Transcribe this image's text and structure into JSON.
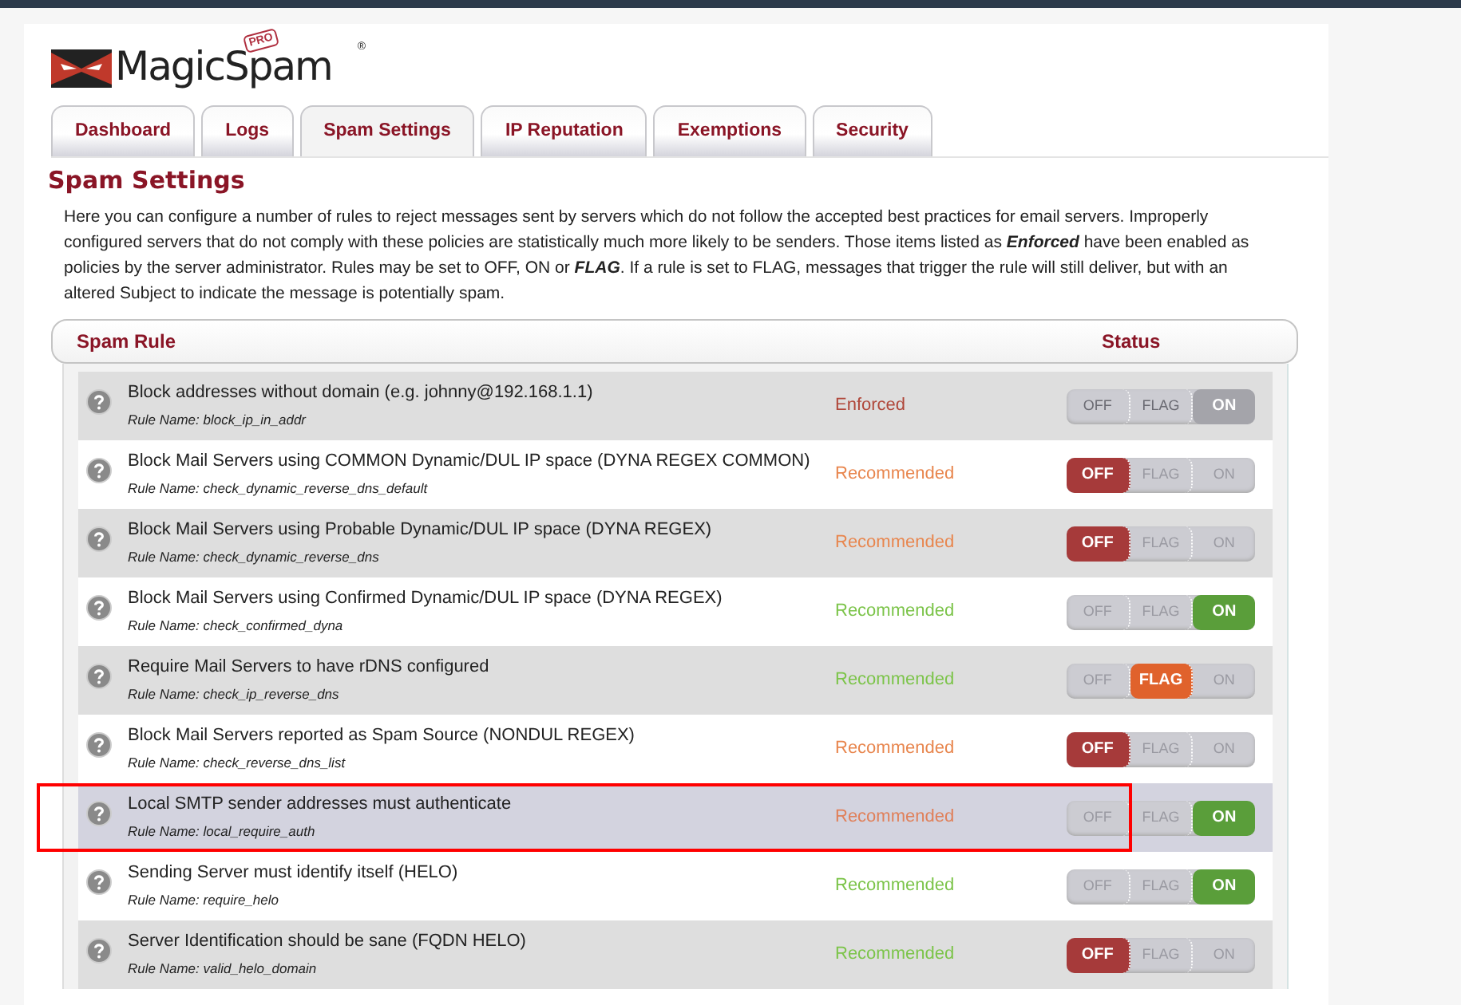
{
  "logo": {
    "name": "MagicSpam",
    "badge": "PRO",
    "mark": "®"
  },
  "tabs": [
    {
      "label": "Dashboard",
      "selected": false
    },
    {
      "label": "Logs",
      "selected": false
    },
    {
      "label": "Spam Settings",
      "selected": true
    },
    {
      "label": "IP Reputation",
      "selected": false
    },
    {
      "label": "Exemptions",
      "selected": false
    },
    {
      "label": "Security",
      "selected": false
    }
  ],
  "heading": "Spam Settings",
  "intro": "Here you can configure a number of rules to reject messages sent by servers which do not follow the accepted best practices for email servers. Improperly configured servers that do not comply with these policies are statistically much more likely to be senders. Those items listed as **Enforced** have been enabled as policies by the server administrator. Rules may be set to OFF, ON or **FLAG**. If a rule is set to FLAG, messages that trigger the rule will still deliver, but with an altered Subject to indicate the message is potentially spam.",
  "table": {
    "columns": [
      "Spam Rule",
      "Status"
    ],
    "rows": [
      {
        "title": "Block addresses without domain (e.g. johnny@192.168.1.1)",
        "rule_name": "Rule Name: block_ip_in_addr",
        "status": "Enforced",
        "color": "#b0473a",
        "disabled": true,
        "highlighted": false,
        "options": [
          {
            "label": "OFF",
            "selected": false
          },
          {
            "label": "FLAG",
            "selected": false
          },
          {
            "label": "ON",
            "selected": true
          }
        ]
      },
      {
        "title": "Block Mail Servers using COMMON Dynamic/DUL IP space (DYNA REGEX COMMON)",
        "rule_name": "Rule Name: check_dynamic_reverse_dns_default",
        "status": "Recommended",
        "color": "#e8864e",
        "disabled": false,
        "highlighted": false,
        "options": [
          {
            "label": "OFF",
            "selected": true
          },
          {
            "label": "FLAG",
            "selected": false
          },
          {
            "label": "ON",
            "selected": false
          }
        ]
      },
      {
        "title": "Block Mail Servers using Probable Dynamic/DUL IP space (DYNA REGEX)",
        "rule_name": "Rule Name: check_dynamic_reverse_dns",
        "status": "Recommended",
        "color": "#e8864e",
        "disabled": false,
        "highlighted": false,
        "options": [
          {
            "label": "OFF",
            "selected": true
          },
          {
            "label": "FLAG",
            "selected": false
          },
          {
            "label": "ON",
            "selected": false
          }
        ]
      },
      {
        "title": "Block Mail Servers using Confirmed Dynamic/DUL IP space (DYNA REGEX)",
        "rule_name": "Rule Name: check_confirmed_dyna",
        "status": "Recommended",
        "color": "#7cc44a",
        "disabled": false,
        "highlighted": false,
        "options": [
          {
            "label": "OFF",
            "selected": false
          },
          {
            "label": "FLAG",
            "selected": false
          },
          {
            "label": "ON",
            "selected": true
          }
        ]
      },
      {
        "title": "Require Mail Servers to have rDNS configured",
        "rule_name": "Rule Name: check_ip_reverse_dns",
        "status": "Recommended",
        "color": "#7cc44a",
        "disabled": false,
        "highlighted": false,
        "options": [
          {
            "label": "OFF",
            "selected": false
          },
          {
            "label": "FLAG",
            "selected": true
          },
          {
            "label": "ON",
            "selected": false
          }
        ]
      },
      {
        "title": "Block Mail Servers reported as Spam Source (NONDUL REGEX)",
        "rule_name": "Rule Name: check_reverse_dns_list",
        "status": "Recommended",
        "color": "#e8864e",
        "disabled": false,
        "highlighted": false,
        "options": [
          {
            "label": "OFF",
            "selected": true
          },
          {
            "label": "FLAG",
            "selected": false
          },
          {
            "label": "ON",
            "selected": false
          }
        ]
      },
      {
        "title": "Local SMTP sender addresses must authenticate",
        "rule_name": "Rule Name: local_require_auth",
        "status": "Recommended",
        "color": "#e0805a",
        "disabled": false,
        "highlighted": true,
        "options": [
          {
            "label": "OFF",
            "selected": false
          },
          {
            "label": "FLAG",
            "selected": false
          },
          {
            "label": "ON",
            "selected": true
          }
        ]
      },
      {
        "title": "Sending Server must identify itself (HELO)",
        "rule_name": "Rule Name: require_helo",
        "status": "Recommended",
        "color": "#7cc44a",
        "disabled": false,
        "highlighted": false,
        "options": [
          {
            "label": "OFF",
            "selected": false
          },
          {
            "label": "FLAG",
            "selected": false
          },
          {
            "label": "ON",
            "selected": true
          }
        ]
      },
      {
        "title": "Server Identification should be sane (FQDN HELO)",
        "rule_name": "Rule Name: valid_helo_domain",
        "status": "Recommended",
        "color": "#7cc44a",
        "disabled": false,
        "highlighted": false,
        "options": [
          {
            "label": "OFF",
            "selected": true
          },
          {
            "label": "FLAG",
            "selected": false
          },
          {
            "label": "ON",
            "selected": false
          }
        ]
      }
    ]
  }
}
